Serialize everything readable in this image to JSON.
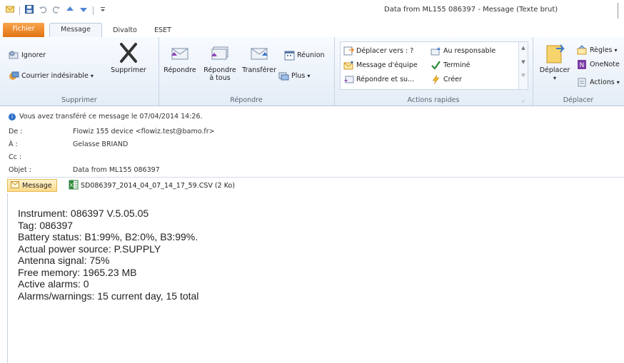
{
  "window": {
    "title": "Data from ML155 086397 - Message (Texte brut)"
  },
  "tabs": [
    {
      "label": "Fichier"
    },
    {
      "label": "Message"
    },
    {
      "label": "Divalto"
    },
    {
      "label": "ESET"
    }
  ],
  "ribbon": {
    "supprimer": {
      "ignorer": "Ignorer",
      "courrier": "Courrier indésirable",
      "supprimer": "Supprimer",
      "label": "Supprimer"
    },
    "repondre": {
      "repondre": "Répondre",
      "repondre_tous_1": "Répondre",
      "repondre_tous_2": "à tous",
      "transferer": "Transférer",
      "reunion": "Réunion",
      "plus": "Plus",
      "label": "Répondre"
    },
    "actions_rapides": {
      "deplacer_vers": "Déplacer vers : ?",
      "message_equipe": "Message d'équipe",
      "repondre_suppr": "Répondre et su...",
      "au_responsable": "Au responsable",
      "termine": "Terminé",
      "creer": "Créer",
      "label": "Actions rapides"
    },
    "deplacer": {
      "deplacer": "Déplacer",
      "regles": "Règles",
      "onenote": "OneNote",
      "actions": "Actions",
      "label": "Déplacer"
    }
  },
  "header": {
    "info": "Vous avez transféré ce message le 07/04/2014 14:26.",
    "de_label": "De :",
    "de_value": "Flowiz 155 device <flowiz.test@bamo.fr>",
    "a_label": "À :",
    "a_value": "Gelasse BRIAND",
    "cc_label": "Cc :",
    "cc_value": "",
    "objet_label": "Objet :",
    "objet_value": "Data from ML155 086397"
  },
  "attachments": {
    "message_tab": "Message",
    "file": "SD086397_2014_04_07_14_17_59.CSV (2 Ko)"
  },
  "body": {
    "lines": [
      "Instrument:  086397 V.5.05.05",
      "Tag: 086397",
      "Battery status: B1:99%, B2:0%, B3:99%.",
      "Actual power source: P.SUPPLY",
      "Antenna signal: 75%",
      "Free memory: 1965.23 MB",
      "Active alarms: 0",
      "Alarms/warnings: 15 current day, 15 total"
    ]
  }
}
